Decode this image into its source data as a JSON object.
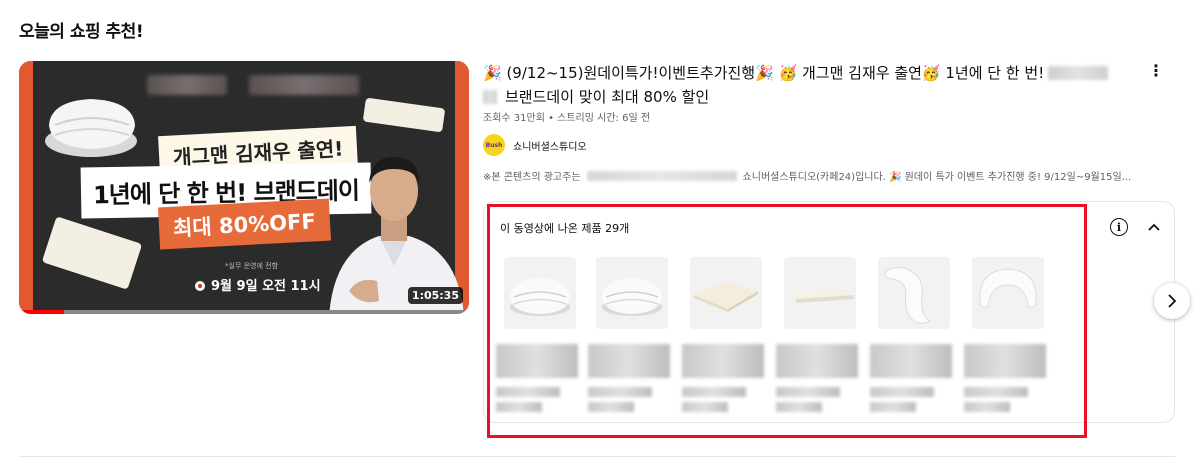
{
  "section": {
    "title": "오늘의 쇼핑 추천!"
  },
  "video": {
    "thumbnail": {
      "ribbon1": "개그맨 김재우 출연!",
      "ribbon2": "1년에 단 한 번! 브랜드데이",
      "ribbon3": "최대 80%OFF",
      "note": "*실무 운영에 전함",
      "date": "9월 9일 오전 11시",
      "duration": "1:05:35",
      "progress_fraction": 0.1
    },
    "title_line1": "🎉 (9/12~15)원데이특가!이벤트추가진행🎉 🥳 개그맨 김재우 출연🥳 1년에 단 한 번!",
    "title_line2": "브랜드데이 맞이 최대 80% 할인",
    "stats": "조회수 31만회 • 스트리밍 시간: 6일 전",
    "channel": {
      "avatar_text": "Bush",
      "name": "쇼니버셜스튜디오"
    },
    "description_prefix": "※본 콘텐츠의 광고주는",
    "description_suffix": "쇼니버셜스튜디오(카페24)입니다. 🎉 원데이 특가 이벤트 추가진행 중! 9/12일~9월15일...",
    "menu_icon": "more-vertical-icon"
  },
  "products_panel": {
    "title": "이 동영상에 나온 제품 29개",
    "info_icon": "info-icon",
    "collapse_icon": "chevron-up-icon",
    "items": [
      {
        "kind": "duvet"
      },
      {
        "kind": "duvet"
      },
      {
        "kind": "mattress-pad"
      },
      {
        "kind": "topper"
      },
      {
        "kind": "body-pillow"
      },
      {
        "kind": "u-pillow"
      }
    ]
  },
  "next_icon": "chevron-right-icon",
  "highlight_color": "#e81123"
}
